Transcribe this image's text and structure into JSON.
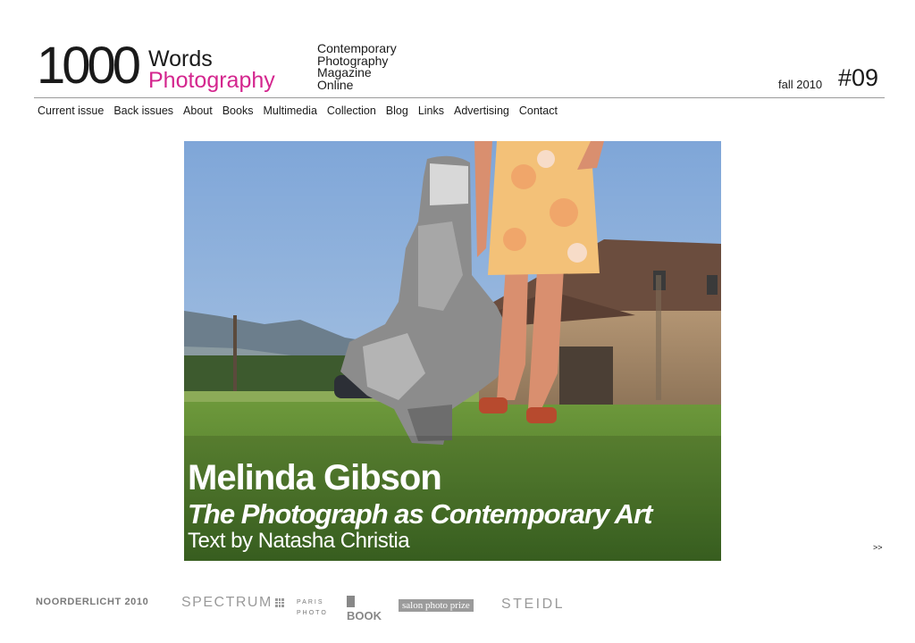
{
  "header": {
    "logo_number": "1000",
    "logo_words": "Words",
    "logo_photography": "Photography",
    "tagline": [
      "Contemporary",
      "Photography",
      "Magazine",
      "Online"
    ],
    "issue_season": "fall 2010",
    "issue_number": "#09"
  },
  "nav": {
    "items": [
      "Current issue",
      "Back issues",
      "About",
      "Books",
      "Multimedia",
      "Collection",
      "Blog",
      "Links",
      "Advertising",
      "Contact"
    ]
  },
  "feature": {
    "artist": "Melinda Gibson",
    "title": "The Photograph as Contemporary Art",
    "credit": "Text by Natasha Christia",
    "next_label": ">>"
  },
  "sponsors": {
    "noorderlicht": "NOORDERLICHT 2010",
    "spectrum": "SPECTRUM",
    "paris_photo_line1": "PARIS",
    "paris_photo_line2": "PHOTO",
    "book": "BOOK",
    "salon": "salon photo prize",
    "steidl": "STEIDL"
  },
  "colors": {
    "brand_pink": "#d4268e",
    "text": "#1a1a1a",
    "rule": "#9a9a9a"
  }
}
